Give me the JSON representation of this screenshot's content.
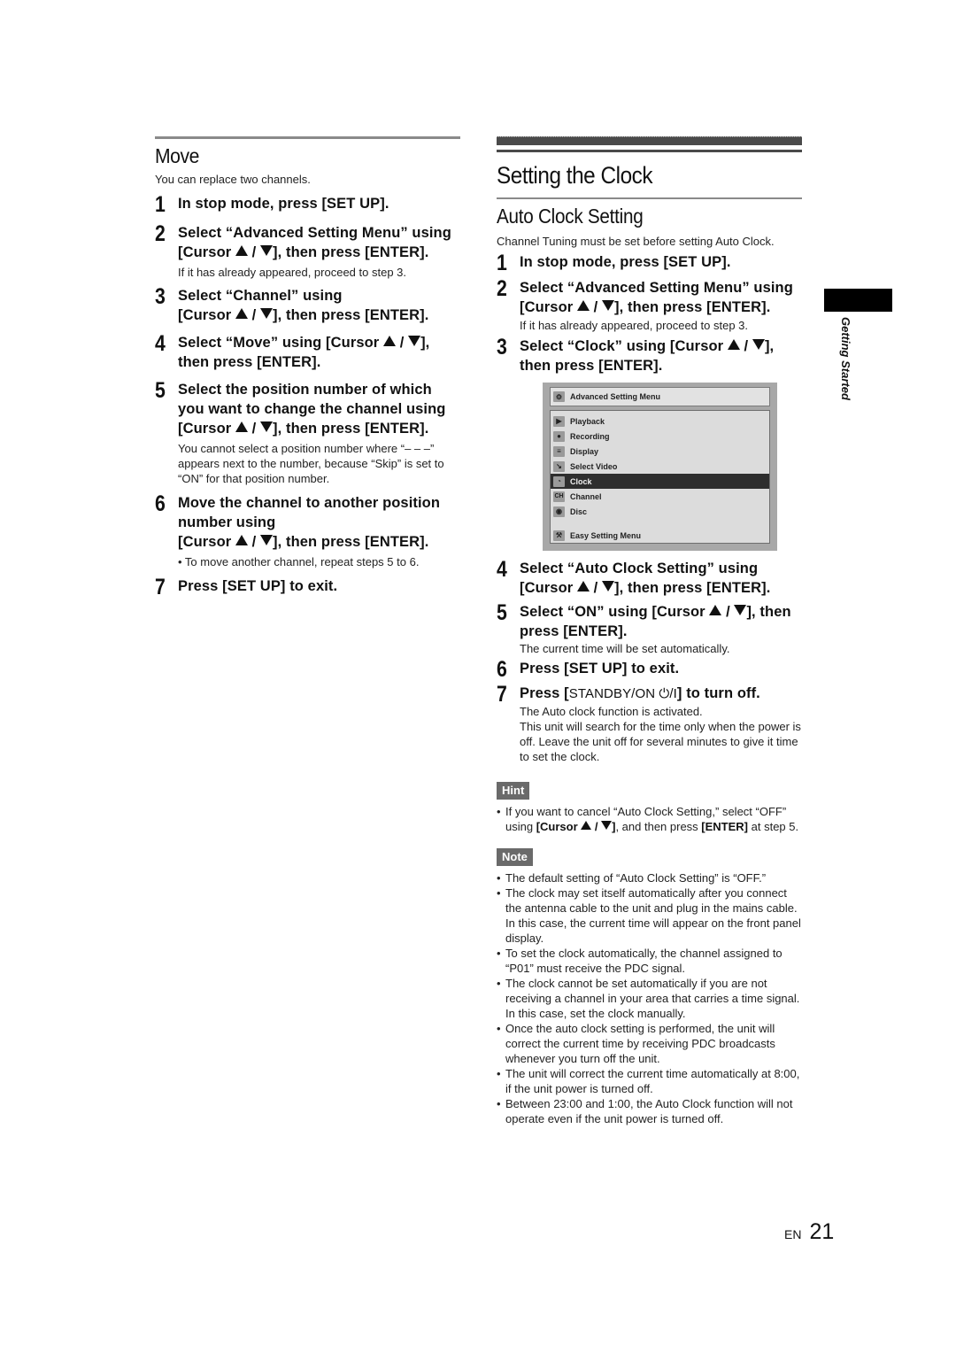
{
  "move": {
    "heading": "Move",
    "intro": "You can replace two channels.",
    "steps": [
      {
        "num": "1",
        "title": "In stop mode, press [SET UP]."
      },
      {
        "num": "2",
        "title_a": "Select “Advanced Setting Menu” using [Cursor ",
        "title_b": " / ",
        "title_c": "], then press [ENTER].",
        "note": "If it has already appeared, proceed to step 3."
      },
      {
        "num": "3",
        "title_a": "Select “Channel” using",
        "title_b": "[Cursor ",
        "title_c": " / ",
        "title_d": "], then press [ENTER]."
      },
      {
        "num": "4",
        "title_a": "Select “Move” using [Cursor ",
        "title_b": " / ",
        "title_c": "], then press [ENTER]."
      },
      {
        "num": "5",
        "title_a": "Select the position number of which you want to change the channel using [Cursor ",
        "title_b": " / ",
        "title_c": "], then press [ENTER].",
        "note": "You cannot select a position number where “– – –” appears next to the number, because “Skip” is set to “ON” for that position number."
      },
      {
        "num": "6",
        "title_a": "Move the channel to another position number using",
        "title_b": "[Cursor ",
        "title_c": " / ",
        "title_d": "], then press [ENTER].",
        "note": "• To move another channel, repeat steps 5 to 6."
      },
      {
        "num": "7",
        "title": "Press [SET UP] to exit."
      }
    ]
  },
  "clock": {
    "heading": "Setting the Clock",
    "subheading": "Auto Clock Setting",
    "intro": "Channel Tuning must be set before setting Auto Clock.",
    "steps": [
      {
        "num": "1",
        "title": "In stop mode, press [SET UP]."
      },
      {
        "num": "2",
        "title_a": "Select “Advanced Setting Menu” using [Cursor ",
        "title_b": " / ",
        "title_c": "], then press [ENTER].",
        "note": "If it has already appeared, proceed to step 3."
      },
      {
        "num": "3",
        "title_a": "Select “Clock” using [Cursor ",
        "title_b": " / ",
        "title_c": "], then press [ENTER]."
      },
      {
        "num": "4",
        "title_a": "Select “Auto Clock Setting” using [Cursor ",
        "title_b": " / ",
        "title_c": "], then press [ENTER]."
      },
      {
        "num": "5",
        "title_a": "Select “ON” using [Cursor ",
        "title_b": " / ",
        "title_c": "], then press [ENTER].",
        "note": "The current time will be set automatically."
      },
      {
        "num": "6",
        "title": "Press [SET UP] to exit."
      },
      {
        "num": "7",
        "title_a": "Press [",
        "title_b": "STANDBY/ON ⏻/I",
        "title_c": "] to turn off.",
        "note_lines": [
          "The Auto clock function is activated.",
          "This unit will search for the time only when the power is off. Leave the unit off for several minutes to give it time to set the clock."
        ]
      }
    ],
    "menu": {
      "title": "Advanced Setting Menu",
      "items": [
        {
          "label": "Playback",
          "icon": "play-icon",
          "glyph": "▶"
        },
        {
          "label": "Recording",
          "icon": "recording-icon",
          "glyph": "●"
        },
        {
          "label": "Display",
          "icon": "display-icon",
          "glyph": "≡"
        },
        {
          "label": "Select Video",
          "icon": "select-video-icon",
          "glyph": "↘"
        },
        {
          "label": "Clock",
          "icon": "clock-icon",
          "glyph": "◔",
          "selected": true
        },
        {
          "label": "Channel",
          "icon": "channel-icon",
          "glyph": "CH"
        },
        {
          "label": "Disc",
          "icon": "disc-icon",
          "glyph": "◉"
        }
      ],
      "footer_item": {
        "label": "Easy Setting Menu",
        "icon": "wrench-icon",
        "glyph": "⚒"
      }
    },
    "hint": {
      "label": "Hint",
      "text_a": "If you want to cancel “Auto Clock Setting,” select “OFF” using ",
      "text_b": "[Cursor ",
      "text_c": " / ",
      "text_d": "]",
      "text_e": ", and then press ",
      "text_f": "[ENTER]",
      "text_g": " at step 5."
    },
    "note": {
      "label": "Note",
      "items": [
        "The default setting of “Auto Clock Setting” is “OFF.”",
        "The clock may set itself automatically after you connect the antenna cable to the unit and plug in the mains cable. In this case, the current time will appear on the front panel display.",
        "To set the clock automatically, the channel assigned to “P01” must receive the PDC signal.",
        "The clock cannot be set automatically if you are not receiving a channel in your area that carries a time signal. In this case, set the clock manually.",
        "Once the auto clock setting is performed, the unit will correct the current time by receiving PDC broadcasts whenever you turn off the unit.",
        "The unit will correct the current time automatically at 8:00, if the unit power is turned off.",
        "Between 23:00 and 1:00, the Auto Clock function will not operate even if the unit power is turned off."
      ]
    }
  },
  "side_tab": {
    "label": "Getting Started"
  },
  "footer": {
    "lang": "EN",
    "page": "21"
  },
  "bullet_char": "•"
}
